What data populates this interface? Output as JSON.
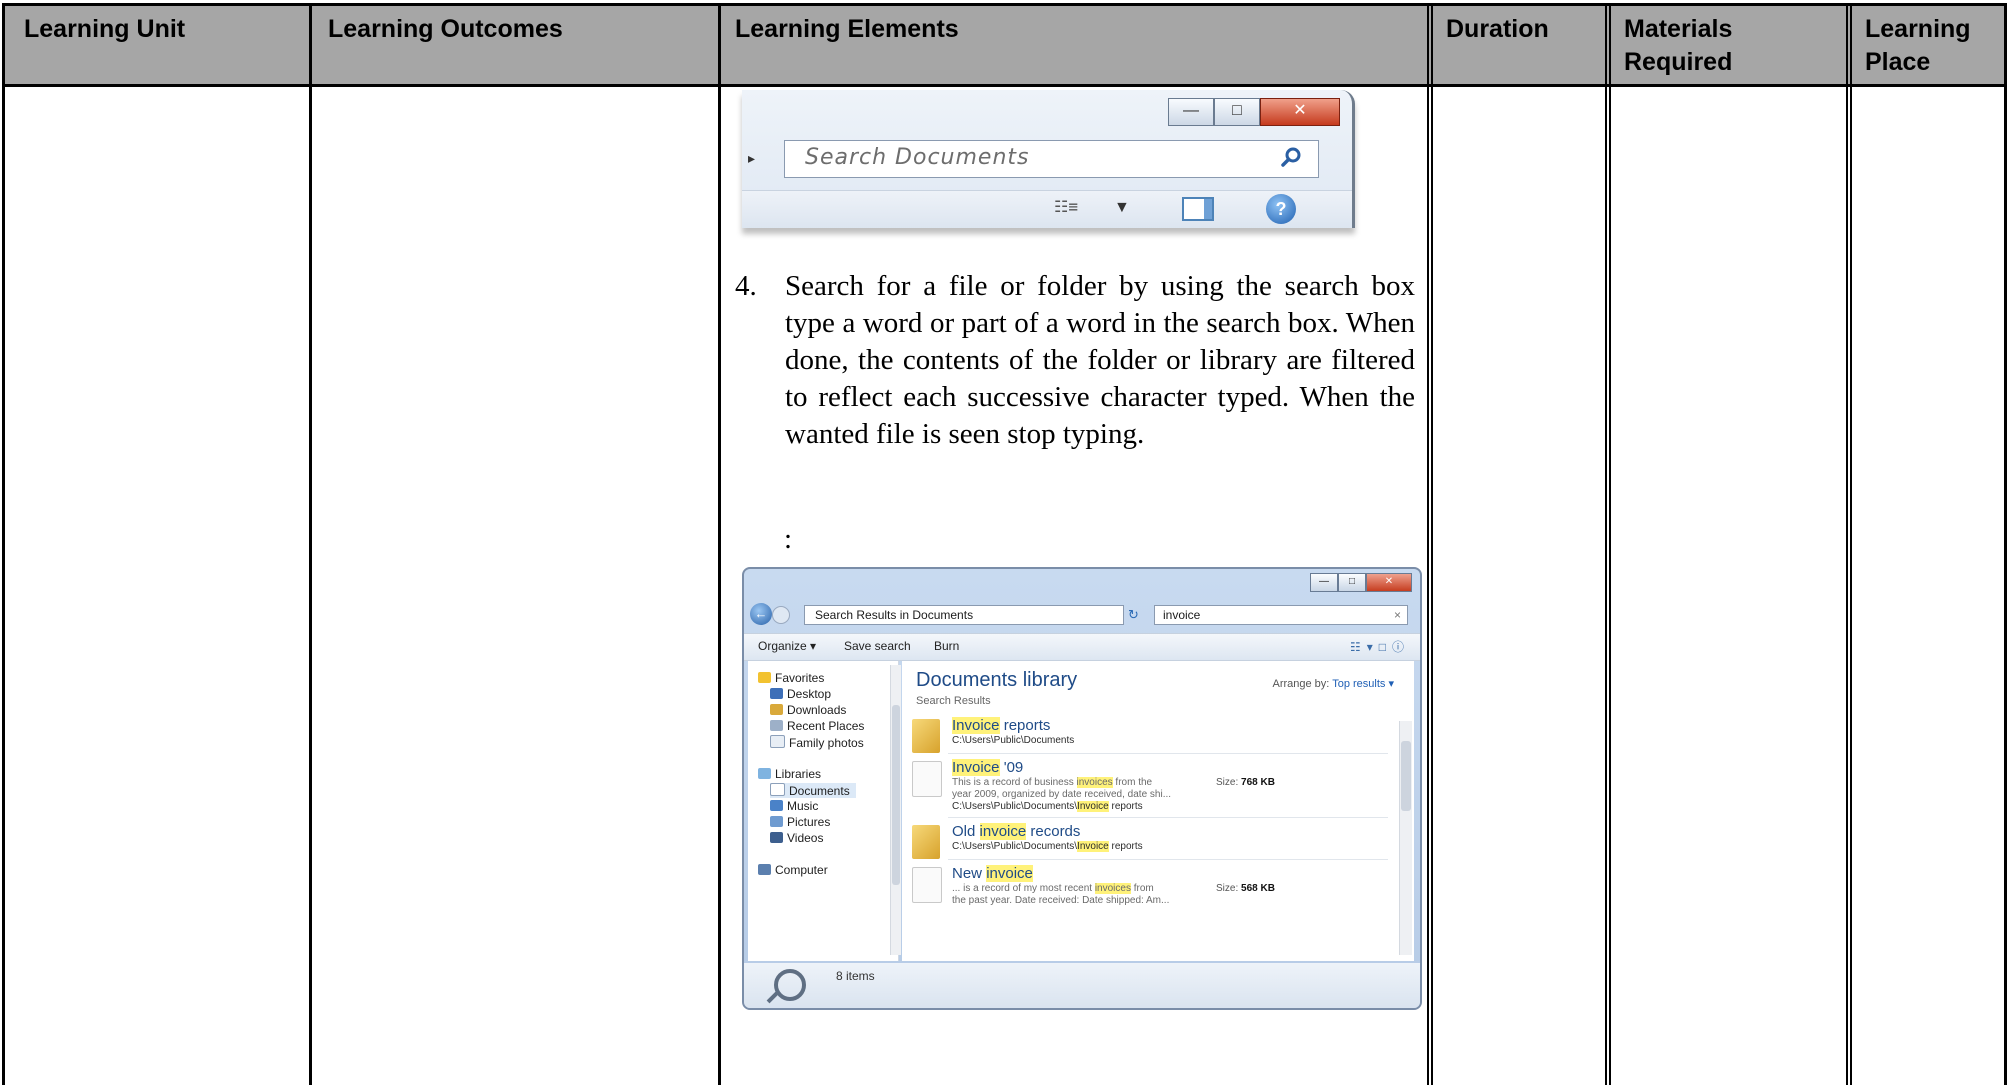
{
  "table": {
    "headers": [
      "Learning Unit",
      "Learning Outcomes",
      "Learning Elements",
      "Duration",
      "Materials Required",
      "Learning Place"
    ]
  },
  "step": {
    "number": "4.",
    "text": "Search for a file or folder by using the search box type a word or part of a word in the search box. When done, the contents of the folder or library are filtered to reflect each successive character typed. When the wanted file is seen stop typing.",
    "colon": ":"
  },
  "screenshot1": {
    "search_placeholder": "Search Documents",
    "icons": [
      "minimize-icon",
      "maximize-icon",
      "close-icon",
      "search-icon",
      "views-icon",
      "preview-pane-icon",
      "help-icon"
    ]
  },
  "screenshot2": {
    "address": "Search Results in Documents",
    "search_value": "invoice",
    "toolbar": [
      "Organize ▾",
      "Save search",
      "Burn"
    ],
    "nav": {
      "favorites_header": "Favorites",
      "favorites": [
        "Desktop",
        "Downloads",
        "Recent Places",
        "Family photos"
      ],
      "libraries_header": "Libraries",
      "libraries": [
        "Documents",
        "Music",
        "Pictures",
        "Videos"
      ],
      "computer": "Computer"
    },
    "library_title": "Documents library",
    "library_subtitle": "Search Results",
    "arrange_label": "Arrange by:",
    "arrange_value": "Top results ▾",
    "results": [
      {
        "hl": "Invoice",
        "rest": " reports",
        "path": "C:\\Users\\Public\\Documents"
      },
      {
        "hl": "Invoice",
        "rest": " '09",
        "desc1_pre": "This is a record of business ",
        "desc1_hl": "invoices",
        "desc1_post": " from the",
        "desc2": "year 2009, organized by date received, date shi...",
        "path_pre": "C:\\Users\\Public\\Documents\\",
        "path_hl": "Invoice",
        "path_post": " reports",
        "size_label": "Size:",
        "size_value": "768 KB"
      },
      {
        "pre": "Old ",
        "hl": "invoice",
        "rest": " records",
        "path_pre": "C:\\Users\\Public\\Documents\\",
        "path_hl": "Invoice",
        "path_post": " reports"
      },
      {
        "pre": "New ",
        "hl": "invoice",
        "rest": "",
        "desc1_pre": "... is a record of my most recent ",
        "desc1_hl": "invoices",
        "desc1_post": " from",
        "desc2": "the past year. Date received: Date shipped: Am...",
        "size_label": "Size:",
        "size_value": "568 KB"
      }
    ],
    "status": "8 items"
  }
}
